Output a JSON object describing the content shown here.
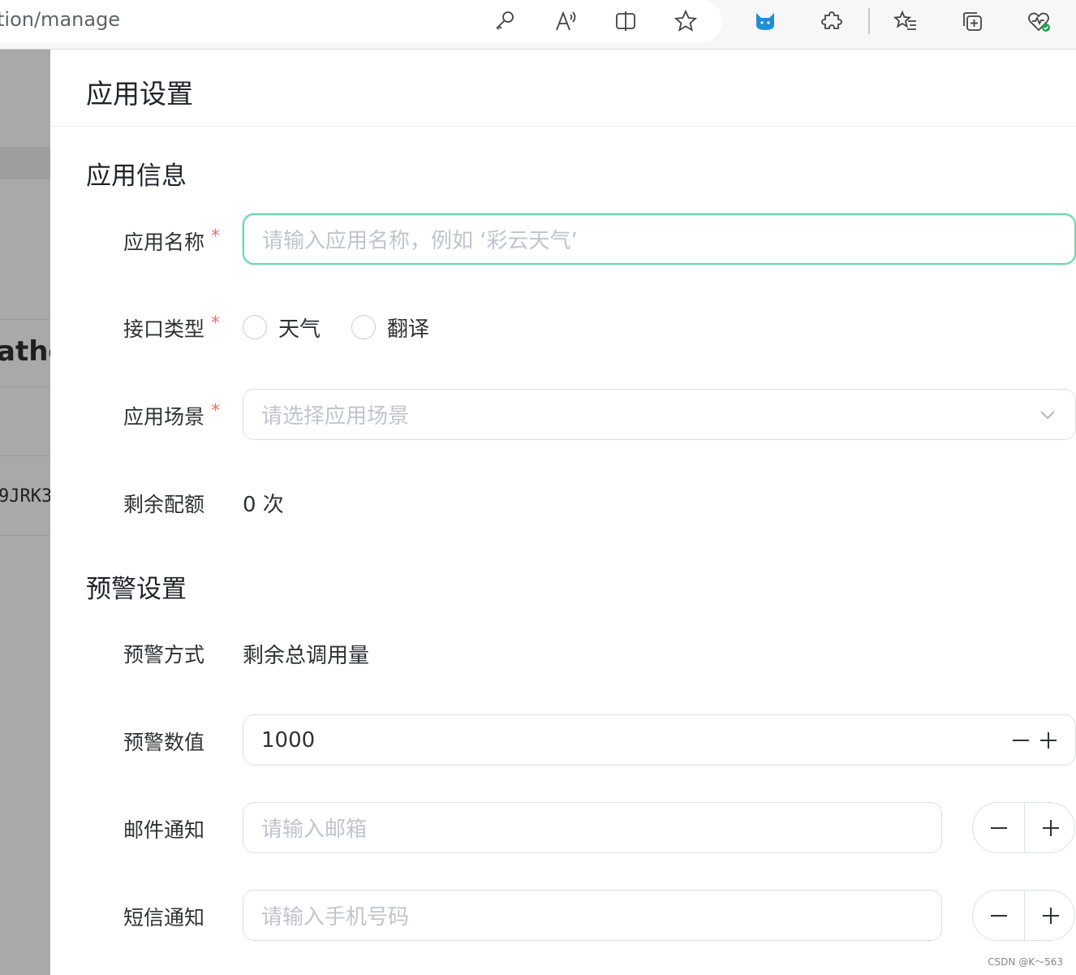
{
  "browser": {
    "address_text": "tion/manage",
    "icons": [
      "key-icon",
      "read-aloud-icon",
      "split-screen-icon",
      "favorite-star-icon",
      "cat-extension-icon",
      "extensions-puzzle-icon",
      "favorites-list-icon",
      "collections-icon",
      "browser-health-icon"
    ]
  },
  "background": {
    "partial_text_large": "athe",
    "partial_text_small": "9JRK3"
  },
  "drawer": {
    "title": "应用设置",
    "section_app_info": "应用信息",
    "app_name": {
      "label": "应用名称",
      "required_mark": "*",
      "placeholder": "请输入应用名称，例如 ‘彩云天气’"
    },
    "api_type": {
      "label": "接口类型",
      "required_mark": "*",
      "options": [
        "天气",
        "翻译"
      ],
      "selected": null
    },
    "scene": {
      "label": "应用场景",
      "required_mark": "*",
      "placeholder": "请选择应用场景"
    },
    "quota": {
      "label": "剩余配额",
      "value": "0 次"
    },
    "section_alert": "预警设置",
    "alert_method": {
      "label": "预警方式",
      "value": "剩余总调用量"
    },
    "alert_value": {
      "label": "预警数值",
      "value": "1000"
    },
    "email_notify": {
      "label": "邮件通知",
      "placeholder": "请输入邮箱"
    },
    "sms_notify": {
      "label": "短信通知",
      "placeholder": "请输入手机号码"
    }
  },
  "watermark": "CSDN @K～563",
  "colors": {
    "focus_border": "#6fd6b0",
    "required": "#f56c6c",
    "overlay": "#a9a9a9"
  }
}
